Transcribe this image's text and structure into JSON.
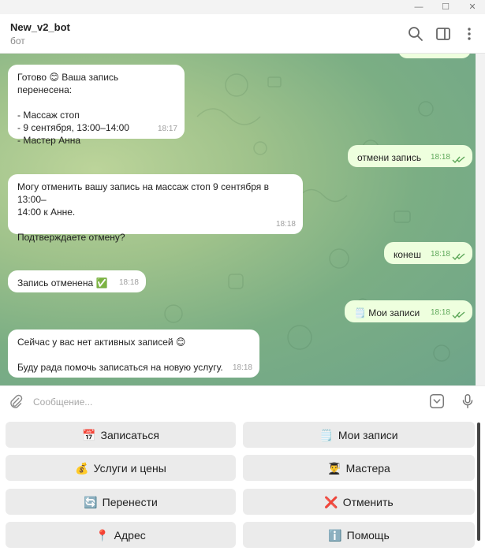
{
  "window": {
    "min_glyph": "—",
    "max_glyph": "☐",
    "close_glyph": "✕"
  },
  "header": {
    "title": "New_v2_bot",
    "subtitle": "бот"
  },
  "messages": [
    {
      "dir": "in",
      "text": "Готово 😊 Ваша запись перенесена:\n\n- Массаж стоп\n- 9 сентября, 13:00–14:00\n- Мастер Анна",
      "time": "18:17"
    },
    {
      "dir": "out",
      "text": "отмени запись",
      "time": "18:18"
    },
    {
      "dir": "in",
      "text": "Могу отменить вашу запись на массаж стоп 9 сентября в 13:00–\n14:00 к Анне.\n\nПодтверждаете отмену?",
      "time": "18:18"
    },
    {
      "dir": "out",
      "text": "конеш",
      "time": "18:18"
    },
    {
      "dir": "in",
      "text": "Запись отменена ✅",
      "time": "18:18"
    },
    {
      "dir": "out",
      "text": "🗒️ Мои записи",
      "time": "18:18"
    },
    {
      "dir": "in",
      "text": "Сейчас у вас нет активных записей 😊\n\nБуду рада помочь записаться на новую услугу.",
      "time": "18:18"
    }
  ],
  "composer": {
    "placeholder": "Сообщение..."
  },
  "keyboard": [
    {
      "emoji": "📅",
      "label": "Записаться"
    },
    {
      "emoji": "🗒️",
      "label": "Мои записи"
    },
    {
      "emoji": "💰",
      "label": "Услуги и цены"
    },
    {
      "emoji": "👨‍🎓",
      "label": "Мастера"
    },
    {
      "emoji": "🔄",
      "label": "Перенести"
    },
    {
      "emoji": "❌",
      "label": "Отменить"
    },
    {
      "emoji": "📍",
      "label": "Адрес"
    },
    {
      "emoji": "ℹ️",
      "label": "Помощь"
    }
  ],
  "colors": {
    "out_bubble": "#eeffde",
    "in_bubble": "#ffffff",
    "check": "#5ea85a"
  }
}
